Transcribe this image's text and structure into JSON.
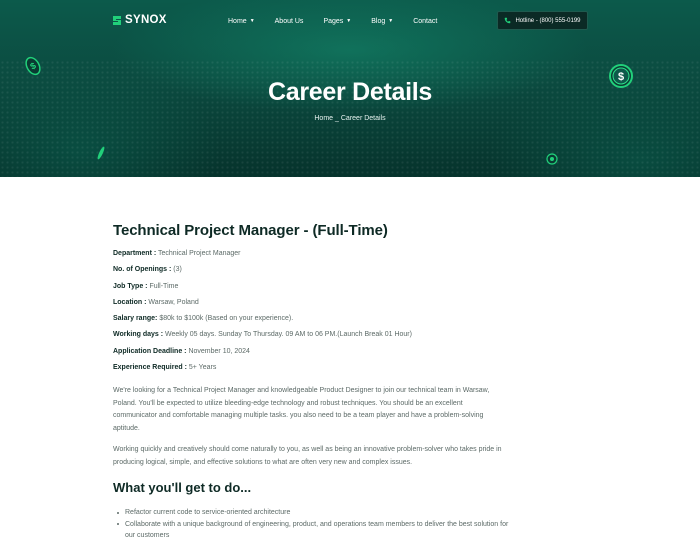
{
  "brand": {
    "name": "SYNOX"
  },
  "nav": {
    "items": [
      {
        "label": "Home",
        "dropdown": true
      },
      {
        "label": "About Us",
        "dropdown": false
      },
      {
        "label": "Pages",
        "dropdown": true
      },
      {
        "label": "Blog",
        "dropdown": true
      },
      {
        "label": "Contact",
        "dropdown": false
      }
    ],
    "caret": "▼",
    "hotline": "Hotline - (800) 555-0199"
  },
  "hero": {
    "title": "Career Details",
    "breadcrumb": {
      "home": "Home",
      "separator": "_",
      "current": "Career Details"
    }
  },
  "job": {
    "title": "Technical Project Manager - (Full-Time)",
    "details": [
      {
        "label": "Department :",
        "value": "Technical Project Manager"
      },
      {
        "label": "No. of Openings :",
        "value": "(3)"
      },
      {
        "label": "Job Type :",
        "value": "Full-Time"
      },
      {
        "label": "Location :",
        "value": "Warsaw, Poland"
      },
      {
        "label": "Salary range:",
        "value": "$80k to $100k (Based on your experience)."
      },
      {
        "label": "Working days :",
        "value": "Weekly 05 days. Sunday To Thursday. 09 AM to 06 PM.(Launch Break 01 Hour)"
      },
      {
        "label": "Application Deadline :",
        "value": "November 10, 2024"
      },
      {
        "label": "Experience Required :",
        "value": "5+ Years"
      }
    ],
    "paragraphs": [
      "We're looking for a Technical Project Manager and knowledgeable Product Designer to join our technical team in Warsaw, Poland. You'll be expected to utilize bleeding-edge technology and robust techniques. You should be an excellent communicator and comfortable managing multiple tasks. you also need to be a team player and have a problem-solving aptitude.",
      "Working quickly and creatively should come naturally to you, as well as being an innovative problem-solver who takes pride in producing logical, simple, and effective solutions to what are often very new and complex issues."
    ],
    "section_heading": "What you'll get to do...",
    "bullets": [
      "Refactor current code to service-oriented architecture",
      "Collaborate with a unique background of engineering, product, and operations team members to deliver the best solution for our customers"
    ]
  },
  "colors": {
    "hero_dark": "#06332c",
    "hero_mid": "#0c5a4b",
    "accent_green": "#21d07a",
    "heading": "#0e2a25",
    "body_text": "#5c6a67"
  }
}
